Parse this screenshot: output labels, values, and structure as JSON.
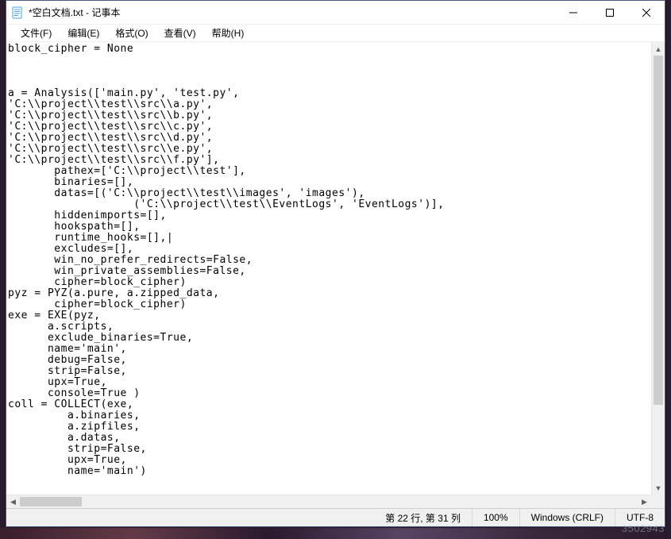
{
  "window": {
    "title": "*空白文档.txt - 记事本"
  },
  "menu": {
    "file": "文件(F)",
    "edit": "编辑(E)",
    "format": "格式(O)",
    "view": "查看(V)",
    "help": "帮助(H)"
  },
  "editor": {
    "content": "block_cipher = None\n\n\n\na = Analysis(['main.py', 'test.py',\n'C:\\\\project\\\\test\\\\src\\\\a.py',\n'C:\\\\project\\\\test\\\\src\\\\b.py',\n'C:\\\\project\\\\test\\\\src\\\\c.py',\n'C:\\\\project\\\\test\\\\src\\\\d.py',\n'C:\\\\project\\\\test\\\\src\\\\e.py',\n'C:\\\\project\\\\test\\\\src\\\\f.py'],\n       pathex=['C:\\\\project\\\\test'],\n       binaries=[],\n       datas=[('C:\\\\project\\\\test\\\\images', 'images'),\n                   ('C:\\\\project\\\\test\\\\EventLogs', 'EventLogs')],\n       hiddenimports=[],\n       hookspath=[],\n       runtime_hooks=[],|\n       excludes=[],\n       win_no_prefer_redirects=False,\n       win_private_assemblies=False,\n       cipher=block_cipher)\npyz = PYZ(a.pure, a.zipped_data,\n       cipher=block_cipher)\nexe = EXE(pyz,\n      a.scripts,\n      exclude_binaries=True,\n      name='main',\n      debug=False,\n      strip=False,\n      upx=True,\n      console=True )\ncoll = COLLECT(exe,\n         a.binaries,\n         a.zipfiles,\n         a.datas,\n         strip=False,\n         upx=True,\n         name='main')"
  },
  "status": {
    "position": "第 22 行, 第 31 列",
    "zoom": "100%",
    "line_ending": "Windows (CRLF)",
    "encoding": "UTF-8"
  },
  "watermark": "3502943"
}
